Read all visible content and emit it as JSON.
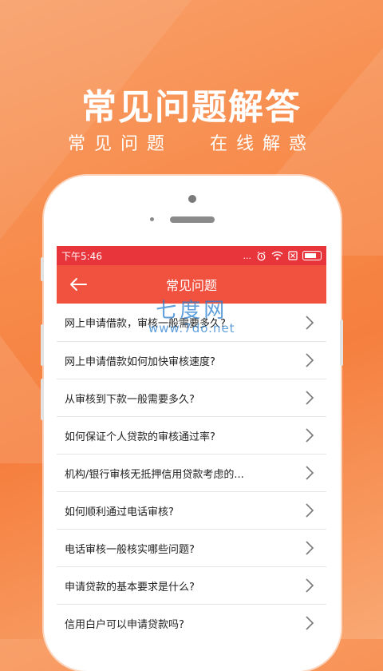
{
  "hero": {
    "title": "常见问题解答",
    "subtitle_left": "常见问题",
    "subtitle_right": "在线解惑"
  },
  "status_bar": {
    "time": "下午5:46",
    "dots": "..."
  },
  "nav": {
    "title": "常见问题",
    "back_icon": "back-arrow-icon"
  },
  "faq": [
    {
      "question": "网上申请借款，审核一般需要多久?"
    },
    {
      "question": "网上申请借款如何加快审核速度?"
    },
    {
      "question": "从审核到下款一般需要多久?"
    },
    {
      "question": "如何保证个人贷款的审核通过率?"
    },
    {
      "question": "机构/银行审核无抵押信用贷款考虑的..."
    },
    {
      "question": "如何顺利通过电话审核?"
    },
    {
      "question": "电话审核一般核实哪些问题?"
    },
    {
      "question": "申请贷款的基本要求是什么?"
    },
    {
      "question": "信用白户可以申请贷款吗?"
    }
  ],
  "watermark": {
    "brand": "七度网",
    "url": "www.7do.net"
  },
  "colors": {
    "status_bar": "#e8343b",
    "nav_bar": "#f0523f",
    "background": "#f78b4b"
  }
}
